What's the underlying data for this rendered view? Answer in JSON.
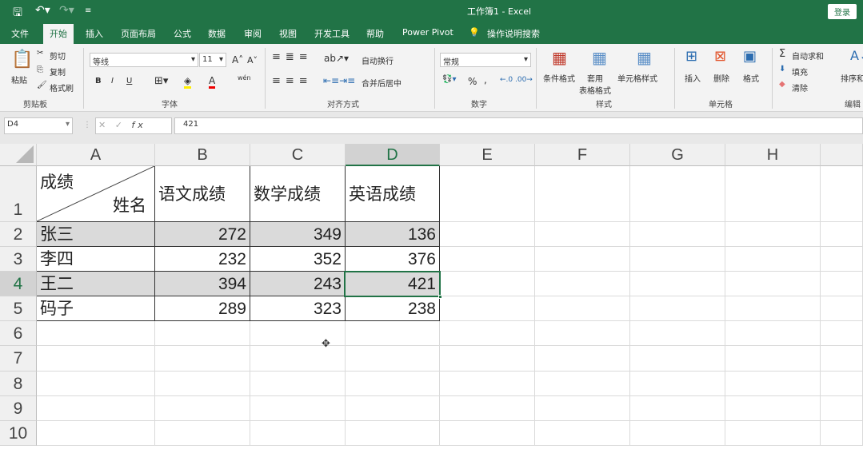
{
  "titlebar": {
    "title": "工作簿1  -  Excel",
    "login": "登录"
  },
  "tabs": [
    "文件",
    "开始",
    "插入",
    "页面布局",
    "公式",
    "数据",
    "审阅",
    "视图",
    "开发工具",
    "帮助",
    "Power Pivot",
    "操作说明搜索"
  ],
  "ribbon": {
    "clipboard": {
      "paste": "粘贴",
      "cut": "剪切",
      "copy": "复制",
      "painter": "格式刷",
      "label": "剪贴板"
    },
    "font": {
      "name": "等线",
      "size": "11",
      "label": "字体",
      "bold": "B",
      "italic": "I",
      "underline": "U",
      "phonetic": "wén"
    },
    "align": {
      "wrap": "自动换行",
      "merge": "合并后居中",
      "label": "对齐方式"
    },
    "number": {
      "format": "常规",
      "percent": "%",
      "comma": ",",
      "label": "数字"
    },
    "styles": {
      "cond": "条件格式",
      "table": "套用\n表格格式",
      "cellstyle": "单元格样式",
      "label": "样式"
    },
    "cells": {
      "insert": "插入",
      "delete": "删除",
      "format": "格式",
      "label": "单元格"
    },
    "editing": {
      "autosum": "自动求和",
      "fill": "填充",
      "clear": "清除",
      "sort": "排序和",
      "label": "编辑"
    }
  },
  "formula": {
    "namebox": "D4",
    "fx": "fx",
    "value": "421"
  },
  "columns": [
    "A",
    "B",
    "C",
    "D",
    "E",
    "F",
    "G",
    "H"
  ],
  "rows": [
    "1",
    "2",
    "3",
    "4",
    "5",
    "6",
    "7",
    "8",
    "9",
    "10"
  ],
  "header": {
    "diag_top": "成绩",
    "diag_bottom": "姓名",
    "b": "语文成绩",
    "c": "数学成绩",
    "d": "英语成绩"
  },
  "data": [
    [
      "张三",
      "272",
      "349",
      "136"
    ],
    [
      "李四",
      "232",
      "352",
      "376"
    ],
    [
      "王二",
      "394",
      "243",
      "421"
    ],
    [
      "码子",
      "289",
      "323",
      "238"
    ]
  ]
}
